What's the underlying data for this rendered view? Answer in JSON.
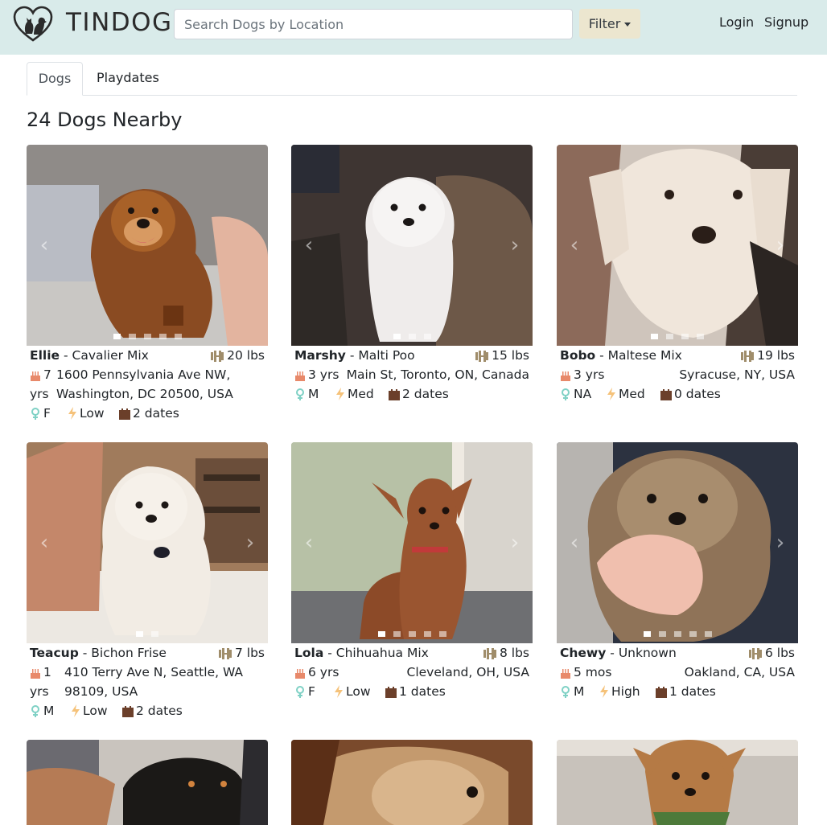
{
  "navbar": {
    "brand": "TINDOG",
    "search_placeholder": "Search Dogs by Location",
    "filter_label": "Filter",
    "login_label": "Login",
    "signup_label": "Signup"
  },
  "tabs": [
    {
      "label": "Dogs",
      "active": true
    },
    {
      "label": "Playdates",
      "active": false
    }
  ],
  "heading": "24 Dogs Nearby",
  "icons": {
    "logo": "heart-dog-cat-logo",
    "weight": "dumbbell-icon",
    "age": "birthday-cake-icon",
    "gender": "gender-icon",
    "energy": "lightning-bolt-icon",
    "dates": "calendar-icon",
    "prev": "carousel-prev-icon",
    "next": "carousel-next-icon"
  },
  "dogs": [
    {
      "name": "Ellie",
      "breed": "- Cavalier Mix",
      "weight": "20 lbs",
      "age_num": "7",
      "age_unit": "yrs",
      "address_line1": "1600 Pennsylvania Ave NW,",
      "address_line2": "Washington, DC 20500, USA",
      "gender": "F",
      "energy": "Low",
      "dates": "2 dates",
      "photo_count": 5,
      "active_photo": 1
    },
    {
      "name": "Marshy",
      "breed": "- Malti Poo",
      "weight": "15 lbs",
      "age": "3 yrs",
      "location": "Main St, Toronto, ON, Canada",
      "gender": "M",
      "energy": "Med",
      "dates": "2 dates",
      "photo_count": 3,
      "active_photo": 1
    },
    {
      "name": "Bobo",
      "breed": "- Maltese Mix",
      "weight": "19 lbs",
      "age": "3 yrs",
      "location": "Syracuse, NY, USA",
      "gender": "NA",
      "energy": "Med",
      "dates": "0 dates",
      "photo_count": 4,
      "active_photo": 1
    },
    {
      "name": "Teacup",
      "breed": "- Bichon Frise",
      "weight": "7 lbs",
      "age_num": "1",
      "age_unit": "yrs",
      "address_line1": "410 Terry Ave N, Seattle, WA",
      "address_line2": "98109, USA",
      "gender": "M",
      "energy": "Low",
      "dates": "2 dates",
      "photo_count": 2,
      "active_photo": 1
    },
    {
      "name": "Lola",
      "breed": "- Chihuahua Mix",
      "weight": "8 lbs",
      "age": "6 yrs",
      "location": "Cleveland, OH, USA",
      "gender": "F",
      "energy": "Low",
      "dates": "1 dates",
      "photo_count": 5,
      "active_photo": 1
    },
    {
      "name": "Chewy",
      "breed": "- Unknown",
      "weight": "6 lbs",
      "age": "5 mos",
      "location": "Oakland, CA, USA",
      "gender": "M",
      "energy": "High",
      "dates": "1 dates",
      "photo_count": 5,
      "active_photo": 1
    }
  ],
  "colors": {
    "navbar_bg": "#d9ebea",
    "filter_bg": "#ece6cf",
    "weight_icon": "#a08d6a",
    "age_icon": "#e8896a",
    "gender_icon": "#7fd1c5",
    "energy_icon": "#f5c27a",
    "dates_icon": "#6b3f2a"
  }
}
